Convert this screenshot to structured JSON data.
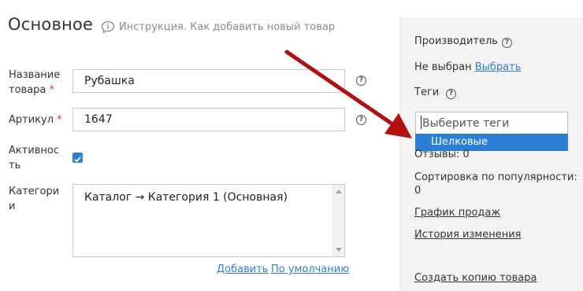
{
  "header": {
    "title": "Основное",
    "hint": "Инструкция. Как добавить новый товар"
  },
  "form": {
    "name_label_1": "Название",
    "name_label_2": "товара",
    "required_mark": "*",
    "name_value": "Рубашка",
    "sku_label": "Артикул",
    "sku_value": "1647",
    "active_label_1": "Активнос",
    "active_label_2": "ть",
    "active_checked": true,
    "category_label_1": "Категори",
    "category_label_2": "и",
    "category_value": "Каталог → Категория 1 (Основная)",
    "add_link": "Добавить",
    "default_link": "По умолчанию",
    "help_glyph": "?"
  },
  "sidebar": {
    "manufacturer_label": "Производитель",
    "manufacturer_value": "Не выбран",
    "manufacturer_choose": "Выбрать",
    "tags_label": "Теги",
    "tags_placeholder": "Выберите теги",
    "tags_option": "Шелковые",
    "reviews": "Отзывы: 0",
    "popularity_label": "Сортировка по популярности:",
    "popularity_value": "0",
    "sales_chart_link": "График продаж",
    "history_link": "История изменения",
    "copy_link": "Создать копию товара"
  },
  "colors": {
    "accent": "#2d7fd3",
    "arrow": "#b01010",
    "required": "#e03a2a"
  }
}
